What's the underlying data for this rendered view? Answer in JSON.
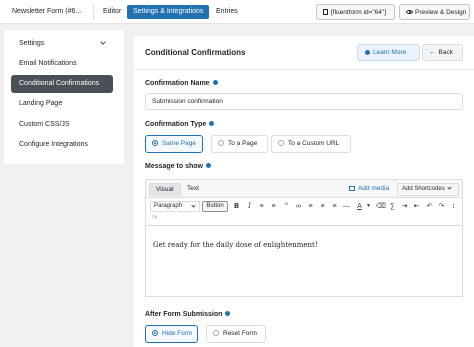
{
  "topbar": {
    "form_title": "Newsletter Form (#6...",
    "nav": [
      "Editor",
      "Settings & Integrations",
      "Entries"
    ],
    "shortcode": "[fluentform id=\"64\"]",
    "preview_label": "Preview & Design"
  },
  "sidebar": {
    "items": [
      {
        "label": "Settings"
      },
      {
        "label": "Email Notifications"
      },
      {
        "label": "Conditional Confirmations"
      },
      {
        "label": "Landing Page"
      },
      {
        "label": "Custom CSS/JS"
      },
      {
        "label": "Configure Integrations"
      }
    ],
    "active_index": 2
  },
  "panel": {
    "title": "Conditional Confirmations",
    "learn_more": "Learn More",
    "back": "Back",
    "confirmation_name_label": "Confirmation Name",
    "confirmation_name_value": "Submission confirmation",
    "confirmation_type_label": "Confirmation Type",
    "confirmation_types": [
      "Same Page",
      "To a Page",
      "To a Custom URL"
    ],
    "confirmation_type_selected": "Same Page",
    "message_label": "Message to show",
    "editor": {
      "tabs": [
        "Visual",
        "Text"
      ],
      "active_tab": "Visual",
      "add_media": "Add media",
      "add_shortcodes": "Add Shortcodes",
      "format_select": "Paragraph",
      "button_label": "Button",
      "toolbar_icons": [
        "bold-icon",
        "italic-icon",
        "bullet-list-icon",
        "numbered-list-icon",
        "blockquote-icon",
        "link-icon",
        "align-left-icon",
        "align-center-icon",
        "align-right-icon",
        "text-color-icon",
        "clear-format-icon",
        "indent-icon",
        "outdent-icon",
        "undo-icon",
        "redo-icon"
      ],
      "content": "Get ready for the daily dose of enlightenment!"
    },
    "after_submission_label": "After Form Submission",
    "after_submission_options": [
      "Hide Form",
      "Reset Form"
    ],
    "after_submission_selected": "Hide Form"
  },
  "colors": {
    "accent": "#2271b1",
    "sidebar_active_bg": "#4b4f56"
  }
}
